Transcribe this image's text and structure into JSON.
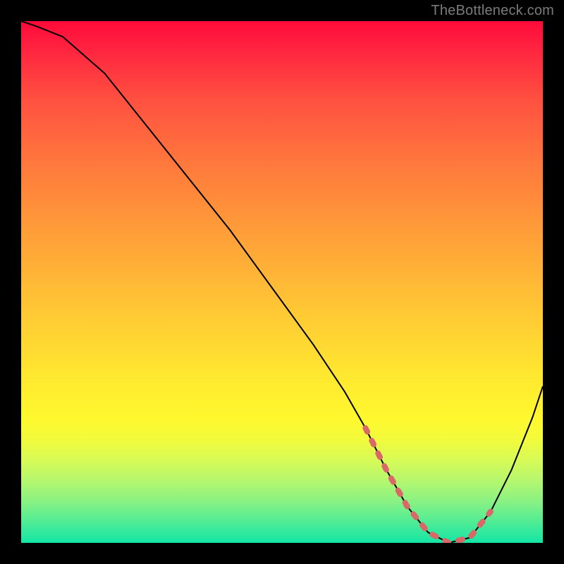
{
  "attribution": "TheBottleneck.com",
  "chart_data": {
    "type": "line",
    "title": "",
    "xlabel": "",
    "ylabel": "",
    "xlim": [
      0,
      100
    ],
    "ylim": [
      0,
      100
    ],
    "grid": false,
    "legend": false,
    "background": "rainbow-vertical-red-to-green",
    "series": [
      {
        "name": "bottleneck-curve",
        "color": "#000000",
        "x": [
          0,
          3,
          8,
          16,
          24,
          32,
          40,
          48,
          56,
          62,
          66,
          70,
          74,
          78,
          82,
          86,
          90,
          94,
          98,
          100
        ],
        "values": [
          100,
          99,
          97,
          90,
          80,
          70,
          60,
          49,
          38,
          29,
          22,
          14,
          7,
          2,
          0,
          1,
          6,
          14,
          24,
          30
        ]
      }
    ],
    "annotations": [
      {
        "name": "optimal-range-dashes",
        "color": "#d96868",
        "style": "dashed",
        "x": [
          66,
          70,
          74,
          78,
          82,
          86,
          90
        ],
        "values": [
          22,
          14,
          7,
          2,
          0,
          1,
          6
        ]
      }
    ]
  }
}
